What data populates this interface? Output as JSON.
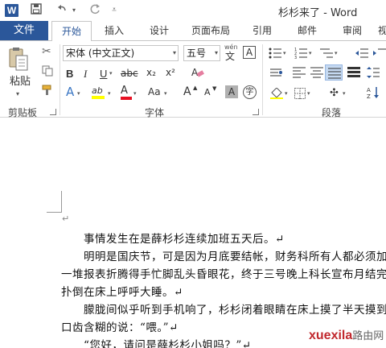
{
  "titlebar": {
    "logo_letter": "W",
    "save_icon": "floppy-disk-icon",
    "undo_icon": "undo-icon",
    "redo_icon": "redo-icon",
    "title": "杉杉来了 - Word"
  },
  "tabs": [
    {
      "label": "文件"
    },
    {
      "label": "开始"
    },
    {
      "label": "插入"
    },
    {
      "label": "设计"
    },
    {
      "label": "页面布局"
    },
    {
      "label": "引用"
    },
    {
      "label": "邮件"
    },
    {
      "label": "审阅"
    },
    {
      "label": "视"
    }
  ],
  "clipboard": {
    "paste_label": "粘贴",
    "group_label": "剪贴板"
  },
  "font": {
    "font_name": "宋体 (中文正文)",
    "font_size": "五号",
    "wen_label": "wén",
    "wen_char": "文",
    "a_box": "A",
    "bold": "B",
    "italic": "I",
    "underline": "U",
    "strike": "abc",
    "subscript": "x₂",
    "superscript": "x²",
    "text_effect": "A",
    "highlight_label": "ab",
    "font_color": "A",
    "change_case": "Aa",
    "grow": "A",
    "shrink": "A",
    "shading_char": "A",
    "enclose_char": "字",
    "group_label": "字体"
  },
  "paragraph": {
    "group_label": "段落"
  },
  "document": {
    "lines": [
      "事情发生在是薛杉杉连续加班五天后。↵",
      "明明是国庆节，可是因为月底要结帐，财务科所有人都必须加",
      "一堆报表折腾得手忙脚乱头昏眼花，终于三号晚上科长宣布月结完",
      "扑倒在床上呼呼大睡。↵",
      "朦胧间似乎听到手机响了，杉杉闭着眼睛在床上摸了半天摸到",
      "口齿含糊的说：“喂。”↵",
      "“您好，请问是薛杉杉小姐吗？”↵"
    ],
    "para_mark": "↵"
  },
  "watermark": {
    "site": "xuexila",
    "text": "路由网"
  },
  "colors": {
    "accent": "#2b579a",
    "highlight": "#ffff00",
    "font_red": "#e81123"
  }
}
